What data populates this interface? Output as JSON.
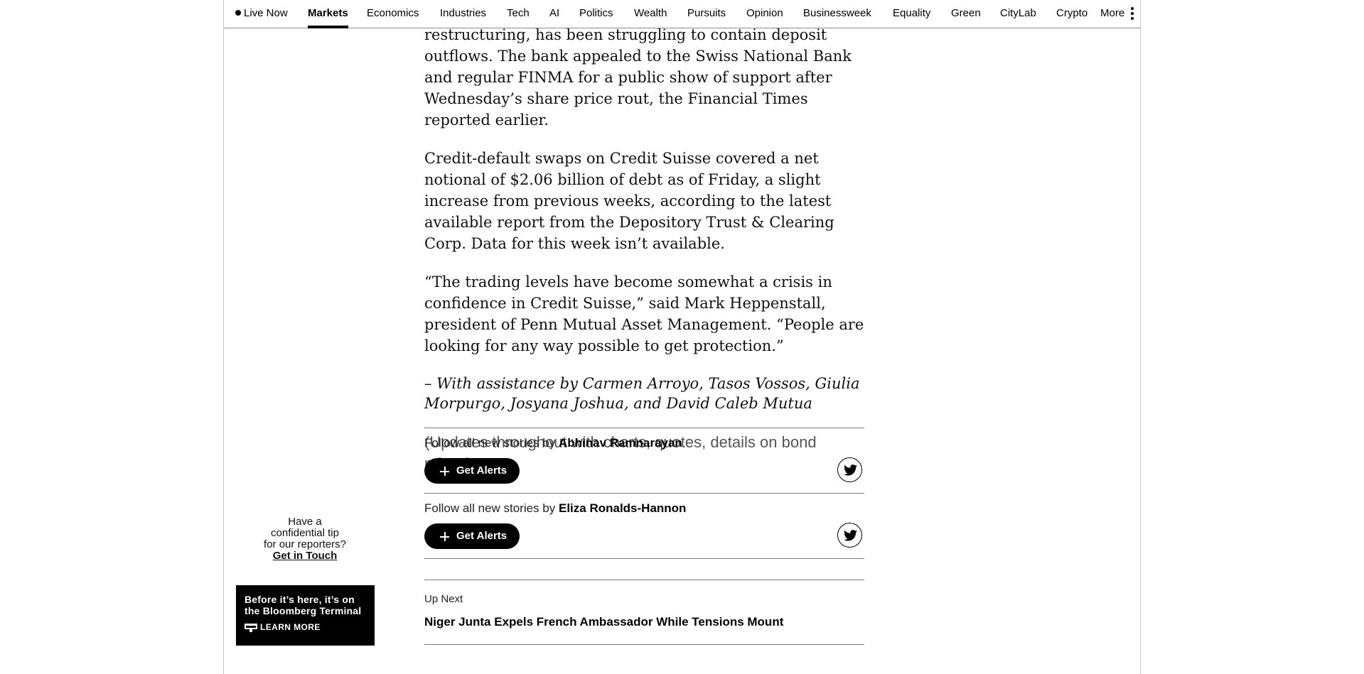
{
  "nav": {
    "live_now": "Live Now",
    "items": [
      "Markets",
      "Economics",
      "Industries",
      "Tech",
      "AI",
      "Politics",
      "Wealth",
      "Pursuits",
      "Opinion",
      "Businessweek",
      "Equality",
      "Green",
      "CityLab",
      "Crypto",
      "More"
    ],
    "active": "Markets"
  },
  "article": {
    "paragraphs": [
      "restructuring, has been struggling to contain deposit outflows. The bank appealed to the Swiss National Bank and regular FINMA for a public show of support after Wednesday’s share price rout, the Financial Times reported earlier.",
      "Credit-default swaps on Credit Suisse covered a net notional of $2.06 billion of debt as of Friday, a slight increase from previous weeks, according to the latest available report from the Depository Trust & Clearing Corp. Data for this week isn’t available.",
      "“The trading levels have become somewhat a crisis in confidence in Credit Suisse,” said Mark Heppenstall, president of Penn Mutual Asset Management. “People are looking for any way possible to get protection.”"
    ],
    "credit": "– With assistance by Carmen Arroyo, Tasos Vossos, Giulia Morpurgo, Josyana Joshua, and David Caleb Mutua",
    "updates": "(Updates throughout with charts, quotes, details on bond prices)"
  },
  "follow": [
    {
      "prefix": "Follow all new stories by",
      "author": "Abhinav Ramnarayan",
      "button": "Get Alerts",
      "social_icon": "twitter-icon"
    },
    {
      "prefix": "Follow all new stories by",
      "author": "Eliza Ronalds-Hannon",
      "button": "Get Alerts",
      "social_icon": "twitter-icon"
    }
  ],
  "up_next": {
    "label": "Up Next",
    "title": "Niger Junta Expels French Ambassador While Tensions Mount"
  },
  "tip": {
    "line1": "Have a",
    "line2": "confidential tip",
    "line3": "for our reporters?",
    "link": "Get in Touch"
  },
  "ad": {
    "title_line1": "Before it’s here, it’s on",
    "title_line2": "the Bloomberg Terminal",
    "cta": "LEARN MORE"
  }
}
